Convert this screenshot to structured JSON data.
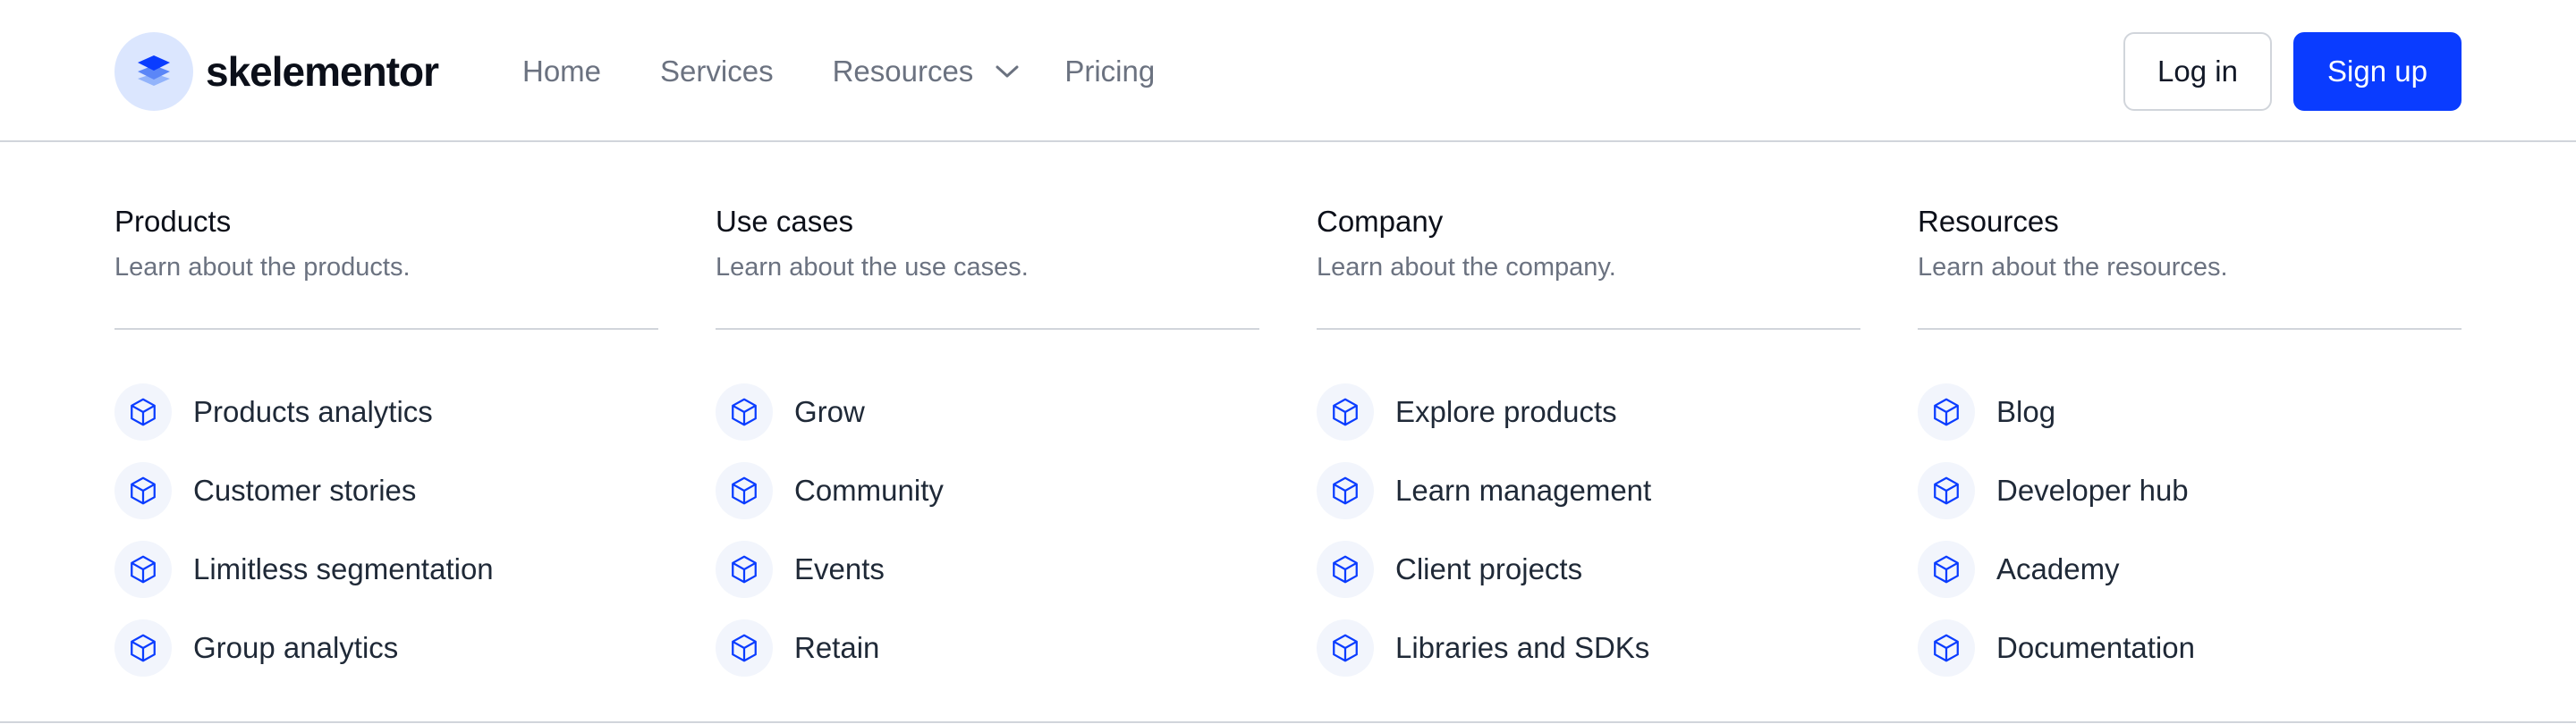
{
  "brand": {
    "name": "skelementor",
    "logo_icon": "stacked-layers-icon",
    "accent_color": "#0a3cff",
    "badge_color": "#dbe6fe"
  },
  "nav": {
    "links": [
      {
        "label": "Home"
      },
      {
        "label": "Services"
      },
      {
        "label": "Resources",
        "icon": "chevron-down-icon",
        "expanded": true
      },
      {
        "label": "Pricing"
      }
    ]
  },
  "auth": {
    "login_label": "Log in",
    "signup_label": "Sign up"
  },
  "mega_menu": {
    "item_icon": "cube-icon",
    "columns": [
      {
        "title": "Products",
        "subtitle": "Learn about the products.",
        "items": [
          "Products analytics",
          "Customer stories",
          "Limitless segmentation",
          "Group analytics"
        ]
      },
      {
        "title": "Use cases",
        "subtitle": "Learn about the use cases.",
        "items": [
          "Grow",
          "Community",
          "Events",
          "Retain"
        ]
      },
      {
        "title": "Company",
        "subtitle": "Learn about the company.",
        "items": [
          "Explore products",
          "Learn management",
          "Client projects",
          "Libraries and SDKs"
        ]
      },
      {
        "title": "Resources",
        "subtitle": "Learn about the resources.",
        "items": [
          "Blog",
          "Developer hub",
          "Academy",
          "Documentation"
        ]
      }
    ]
  }
}
